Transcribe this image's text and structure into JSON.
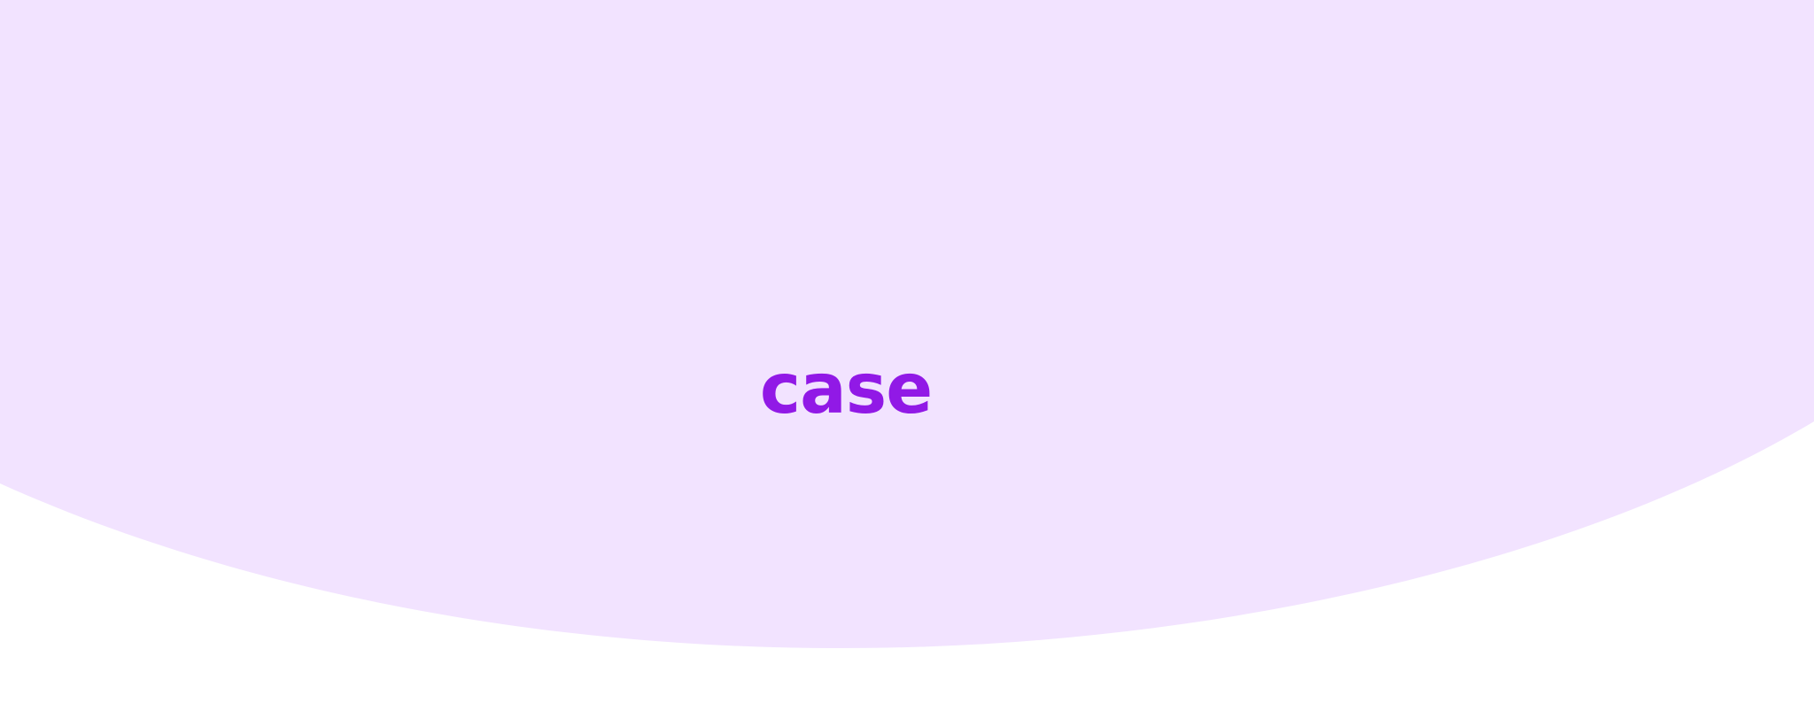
{
  "word": {
    "text": "case"
  },
  "colors": {
    "page_background": "#ffffff",
    "blob_fill": "#f2e3ff",
    "word_color": "#9119e6"
  }
}
